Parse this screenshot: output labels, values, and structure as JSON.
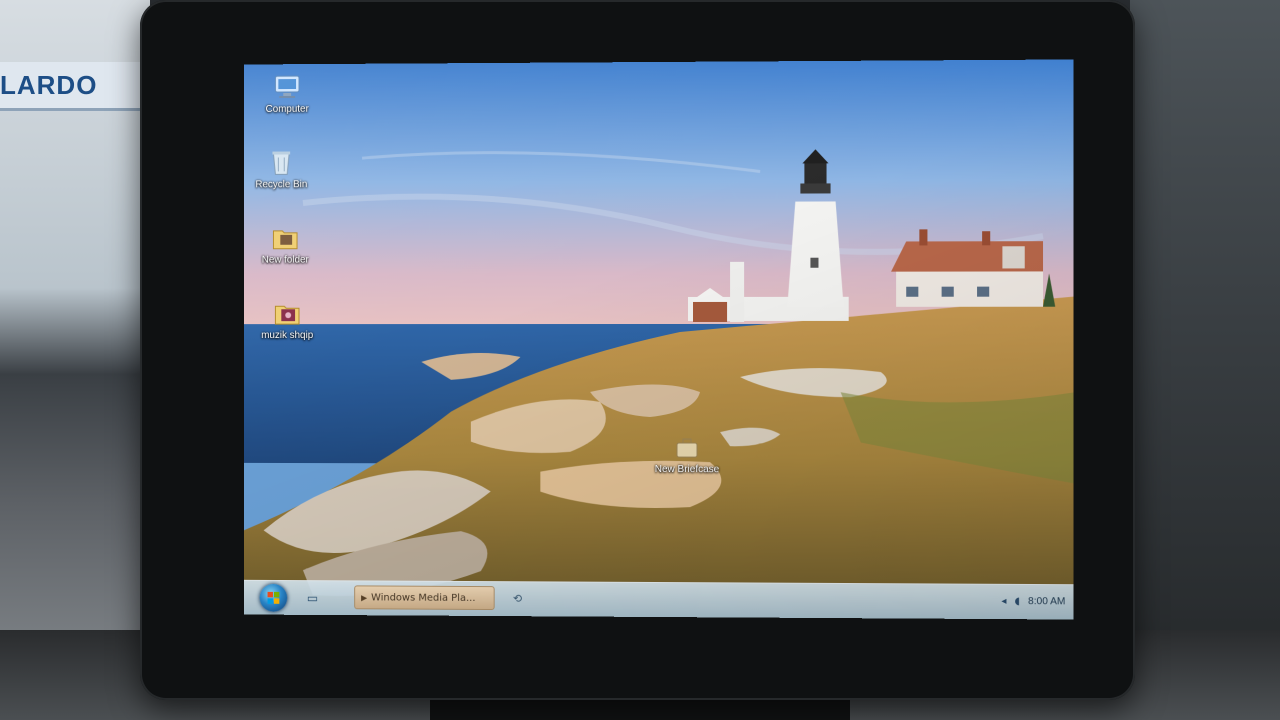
{
  "room": {
    "sign_text": "LARDO"
  },
  "desktop": {
    "icons": [
      {
        "label": "Computer"
      },
      {
        "label": "Recycle Bin"
      },
      {
        "label": "New folder"
      },
      {
        "label": "muzik shqip"
      },
      {
        "label": "New Briefcase"
      }
    ]
  },
  "taskbar": {
    "active_window_label": "Windows Media Pla...",
    "clock": "8:00 AM"
  },
  "colors": {
    "taskbar_tint": "#cfe4f2",
    "active_task": "#e3c7a2",
    "sky_top": "#3f7fcf",
    "sea": "#2f66a8"
  },
  "icons": [
    "computer-icon",
    "recycle-bin-icon",
    "folder-icon",
    "music-folder-icon",
    "briefcase-icon",
    "start-orb-icon",
    "media-player-icon",
    "show-desktop-icon",
    "volume-icon",
    "network-icon"
  ]
}
